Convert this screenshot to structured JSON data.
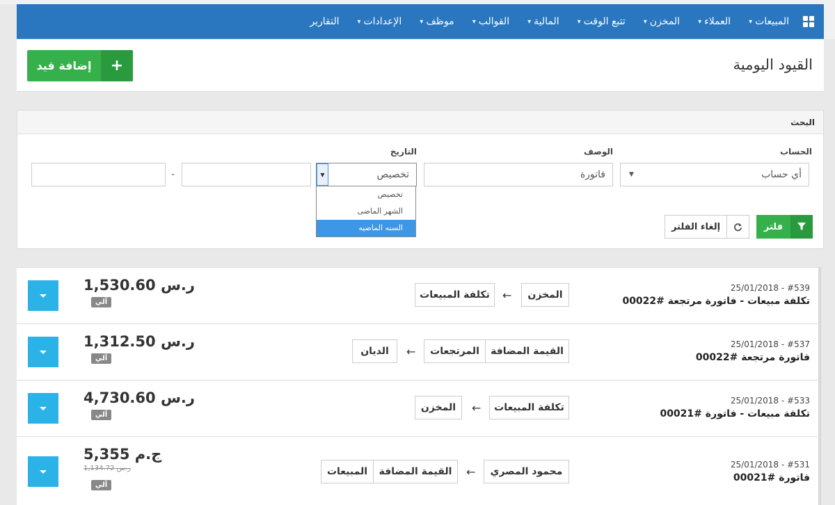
{
  "nav": {
    "items": [
      {
        "label": "المبيعات",
        "caret": true
      },
      {
        "label": "العملاء",
        "caret": true
      },
      {
        "label": "المخزن",
        "caret": true
      },
      {
        "label": "تتبع الوقت",
        "caret": true
      },
      {
        "label": "المالية",
        "caret": true
      },
      {
        "label": "القوالب",
        "caret": true
      },
      {
        "label": "موظف",
        "caret": true
      },
      {
        "label": "الإعدادات",
        "caret": true
      },
      {
        "label": "التقارير",
        "caret": false
      }
    ],
    "icons": {
      "apps": "grid-icon",
      "caret": "chevron-down-icon"
    },
    "colors": {
      "bar": "#2a77c0"
    }
  },
  "header": {
    "title": "القيود اليومية",
    "add_button": "إضافة قيد",
    "add_icon": "plus-icon"
  },
  "search": {
    "heading": "البحث",
    "account_label": "الحساب",
    "account_value": "أي حساب",
    "description_label": "الوصف",
    "description_value": "فاتورة",
    "date_label": "التاريخ",
    "date_value": "تخصيص",
    "date_from": "",
    "date_to": "",
    "range_separator": "-",
    "date_options": [
      "تخصيص",
      "الشهر الماضى",
      "السنه الماضيه"
    ],
    "date_options_highlighted": 2,
    "filter_button": "فلتر",
    "filter_icon": "funnel-icon",
    "reset_button": "إلغاء الفلتر",
    "reset_icon": "refresh-icon"
  },
  "entries": [
    {
      "number": "#539",
      "date": "25/01/2018",
      "title": "تكلفة مبيعات - فاتورة مرتجعة #00022",
      "from": [
        "المخزن"
      ],
      "to": [
        "تكلفة المبيعات"
      ],
      "amount": "1,530.60 ر.س",
      "badge": "آلي"
    },
    {
      "number": "#537",
      "date": "25/01/2018",
      "title": "فاتورة مرتجعة #00022",
      "from": [
        "القيمة المضافة",
        "المرتجعات"
      ],
      "to": [
        "الديان"
      ],
      "amount": "1,312.50 ر.س",
      "badge": "آلي"
    },
    {
      "number": "#533",
      "date": "25/01/2018",
      "title": "تكلفة مبيعات - فاتورة #00021",
      "from": [
        "تكلفة المبيعات"
      ],
      "to": [
        "المخزن"
      ],
      "amount": "4,730.60 ر.س",
      "badge": "آلي"
    },
    {
      "number": "#531",
      "date": "25/01/2018",
      "title": "فاتورة #00021",
      "from": [
        "محمود المصري"
      ],
      "to": [
        "القيمة المضافة",
        "المبيعات"
      ],
      "amount": "5,355 ج.م",
      "sub_amount": "1,134.72 ر.س",
      "badge": "آلي"
    }
  ],
  "arrow_glyph": "←"
}
